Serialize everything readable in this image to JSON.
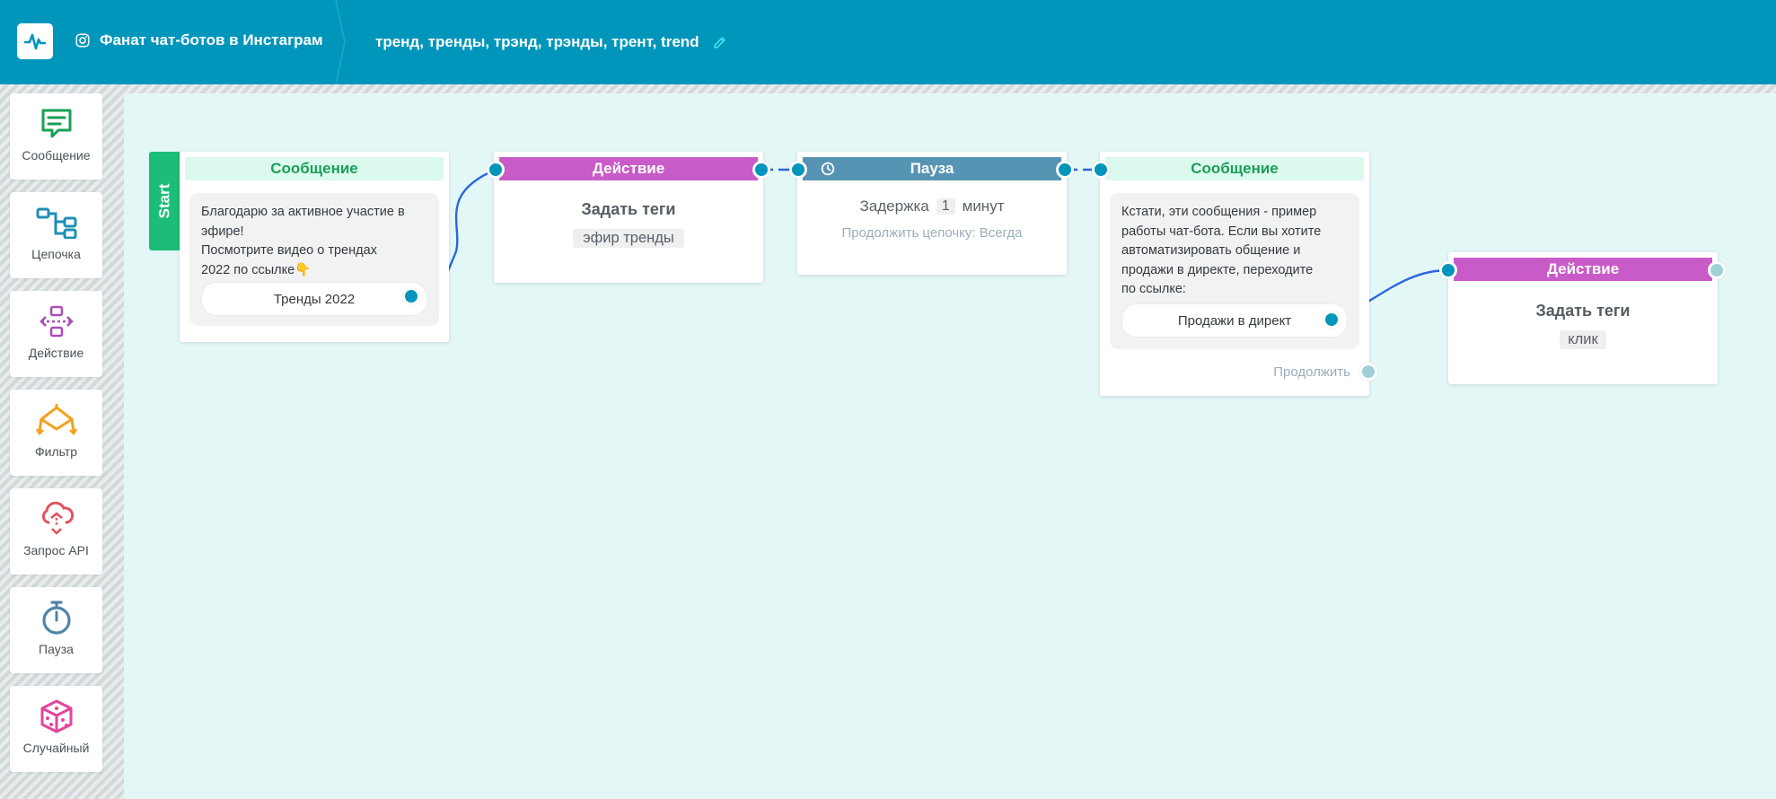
{
  "header": {
    "project_name": "Фанат чат-ботов в Инстаграм",
    "chain_title": "тренд, тренды, трэнд, трэнды, трент, trend",
    "logo_icon": "pulse-logo-icon",
    "project_icon": "instagram-icon",
    "edit_icon": "pencil-icon",
    "bg_color": "#0096bc"
  },
  "palette": [
    {
      "label": "Сообщение",
      "icon": "message-icon",
      "color": "#1a9f57"
    },
    {
      "label": "Цепочка",
      "icon": "chain-icon",
      "color": "#1f8fb5"
    },
    {
      "label": "Действие",
      "icon": "action-icon",
      "color": "#a94fb8"
    },
    {
      "label": "Фильтр",
      "icon": "filter-icon",
      "color": "#f4a11d"
    },
    {
      "label": "Запрос API",
      "icon": "api-request-icon",
      "color": "#e2535f"
    },
    {
      "label": "Пауза",
      "icon": "stopwatch-icon",
      "color": "#4f86a6"
    },
    {
      "label": "Случайный",
      "icon": "dice-icon",
      "color": "#e2459d"
    }
  ],
  "flow": {
    "start_label": "Start",
    "message1": {
      "header": "Сообщение",
      "text": "Благодарю за активное участие в\nэфире!\nПосмотрите видео о трендах\n2022 по ссылке👇",
      "button": "Тренды 2022"
    },
    "action1": {
      "header": "Действие",
      "title": "Задать теги",
      "tag": "эфир тренды"
    },
    "pause": {
      "header": "Пауза",
      "delay_label": "Задержка",
      "delay_value": "1",
      "delay_unit": "минут",
      "continue_text": "Продолжить цепочку: Всегда"
    },
    "message2": {
      "header": "Сообщение",
      "text": "Кстати, эти сообщения - пример\nработы чат-бота. Если вы хотите\nавтоматизировать общение и\nпродажи в директе, переходите\nпо ссылке:",
      "button": "Продажи в директ",
      "continue_label": "Продолжить"
    },
    "action2": {
      "header": "Действие",
      "title": "Задать теги",
      "tag": "клик"
    }
  },
  "colors": {
    "canvas": "#e3f7f7",
    "port": "#0096bc",
    "wire": "#1f5fd6",
    "message_header": "#1a9f57",
    "action_header": "#c95bc8",
    "pause_header": "#5794b4",
    "start": "#1cbd79"
  }
}
